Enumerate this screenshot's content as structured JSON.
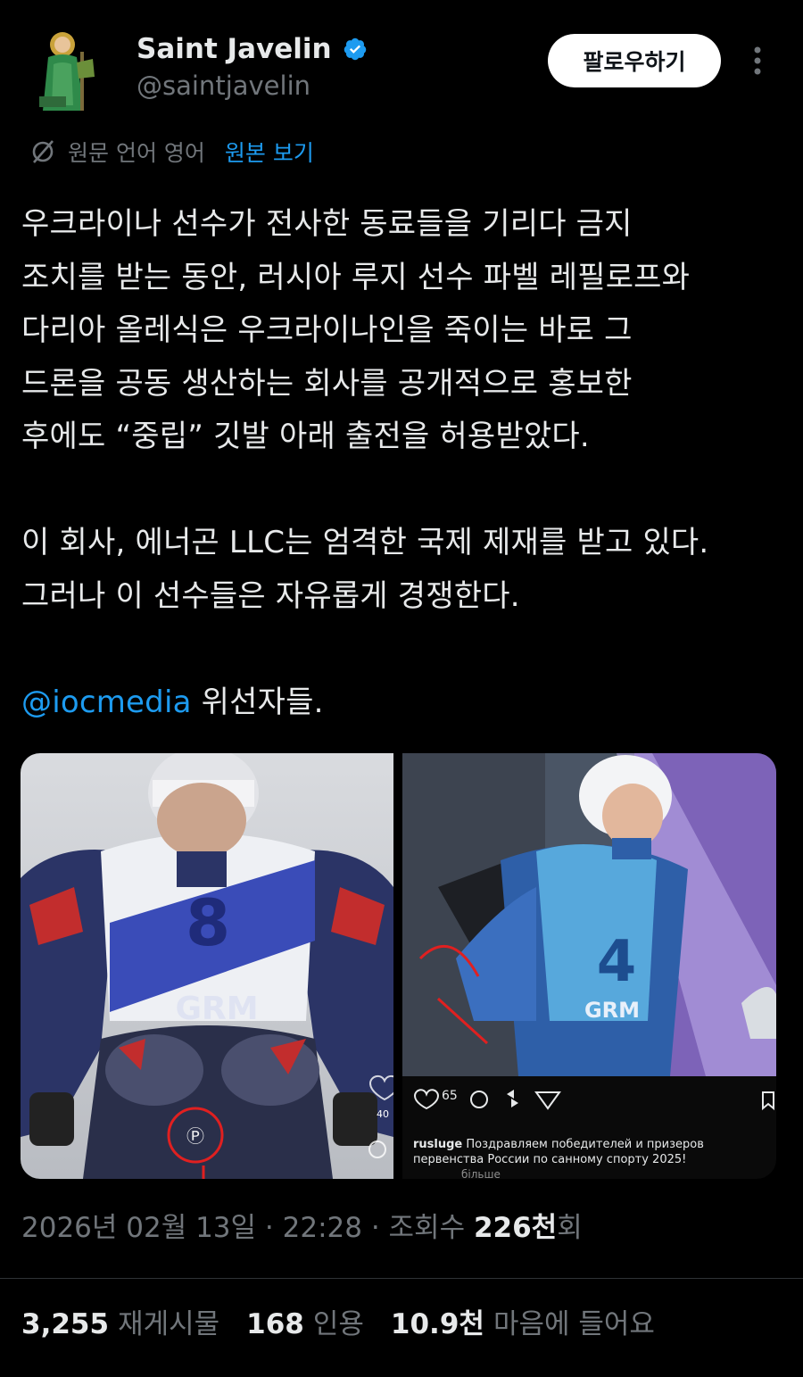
{
  "header": {
    "display_name": "Saint Javelin",
    "handle": "@saintjavelin",
    "follow_label": "팔로우하기"
  },
  "translation": {
    "text": "원문 언어 영어",
    "link": "원본 보기"
  },
  "body": {
    "para1": "우크라이나 선수가 전사한 동료들을 기리다 금지\n조치를 받는 동안, 러시아 루지 선수 파벨 레필로프와\n다리아 올레식은 우크라이나인을 죽이는 바로 그\n드론을 공동 생산하는 회사를 공개적으로 홍보한\n후에도 “중립” 깃발 아래 출전을 허용받았다.",
    "para2": "이 회사, 에너곤 LLC는 엄격한 국제 제재를 받고 있다.\n그러나 이 선수들은 자유롭게 경쟁한다.",
    "mention": "@iocmedia",
    "para3_rest": " 위선자들."
  },
  "media": {
    "left_bib": "8",
    "left_sponsor": "GRM",
    "left_like_count": "40",
    "right_bib": "4",
    "right_sponsor": "GRM",
    "ig_likes": "65",
    "ig_user": "rusluge",
    "ig_caption": "Поздравляем победителей и призеров первенства России по санному спорту 2025!",
    "ig_more": "більше"
  },
  "meta": {
    "date": "2026년 02월 13일",
    "time": "22:28",
    "views_label": "조회수",
    "views_value": "226천",
    "views_suffix": "회"
  },
  "stats": {
    "reposts_value": "3,255",
    "reposts_label": "재게시물",
    "quotes_value": "168",
    "quotes_label": "인용",
    "likes_value": "10.9천",
    "likes_label": "마음에 들어요"
  },
  "colors": {
    "accent": "#1d9bf0",
    "text": "#e7e9ea",
    "muted": "#71767b",
    "background": "#000000"
  }
}
